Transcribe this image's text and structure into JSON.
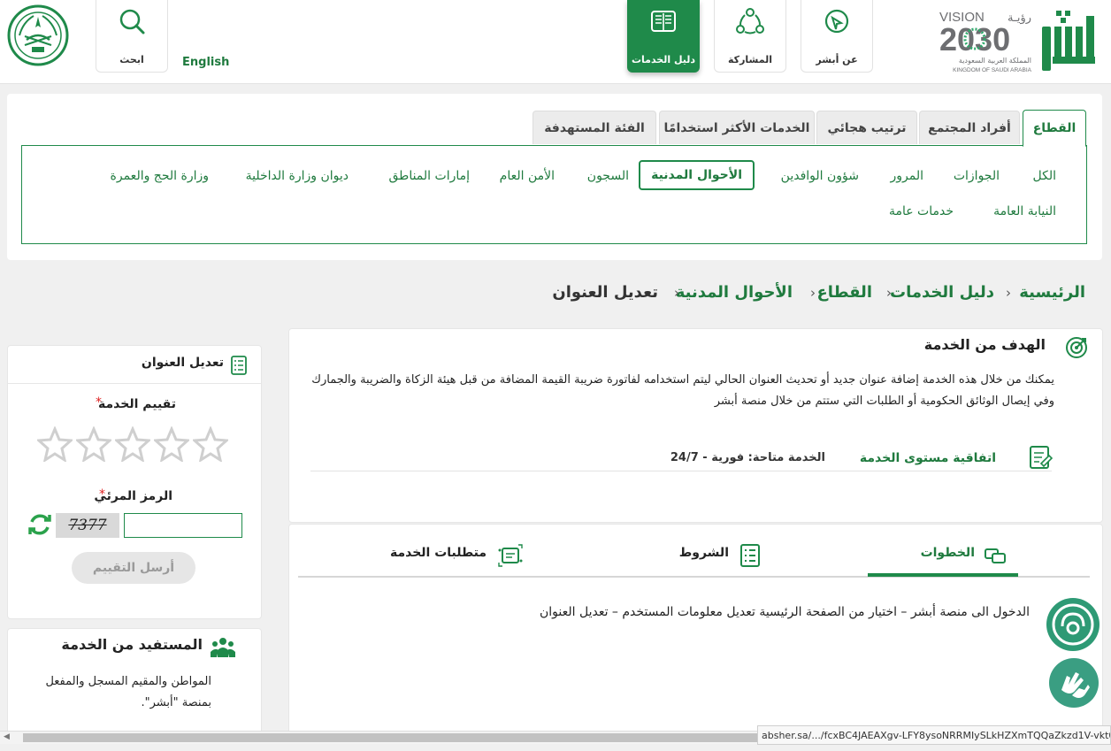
{
  "header": {
    "logo_top": "أبشر",
    "vision_word": "VISION",
    "vision_ar": "رؤيـة",
    "vision_year": "2030",
    "vision_kingdom_ar": "المملكة العربية السعودية",
    "vision_kingdom_en": "KINGDOM OF SAUDI ARABIA",
    "nav": [
      {
        "label": "عن أبشر",
        "icon": "absher-logo-icon"
      },
      {
        "label": "المشاركة",
        "icon": "share-network-icon"
      },
      {
        "label": "دليل الخدمات",
        "icon": "book-icon"
      }
    ],
    "english": "English",
    "search": {
      "label": "ابحث",
      "icon": "search-icon"
    }
  },
  "category": {
    "tabs": [
      "القطاع",
      "أفراد المجتمع",
      "ترتيب هجائي",
      "الخدمات الأكثر استخدامًا",
      "الفئة المستهدفة"
    ],
    "items_row1": [
      "الكل",
      "الجوازات",
      "المرور",
      "شؤون الوافدين",
      "الأحوال المدنية",
      "السجون",
      "الأمن العام",
      "إمارات المناطق",
      "ديوان وزارة الداخلية",
      "وزارة الحج والعمرة"
    ],
    "items_row2": [
      "النيابة العامة",
      "خدمات عامة"
    ]
  },
  "breadcrumb": [
    "الرئيسية",
    "دليل الخدمات",
    "القطاع",
    "الأحوال المدنية",
    "تعديل العنوان"
  ],
  "goal": {
    "title": "الهدف من الخدمة",
    "text": "يمكنك من خلال هذه الخدمة إضافة عنوان جديد أو تحديث العنوان الحالي ليتم استخدامه لفاتورة ضريبة القيمة المضافة من قبل هيئة الزكاة والضريبة والجمارك وفي إيصال الوثائق الحكومية أو الطلبات التي ستتم من خلال منصة أبشر",
    "sla_label": "اتفاقية مستوى الخدمة",
    "sla_value": "الخدمة متاحة: فورية - 24/7"
  },
  "steps": {
    "tabs": [
      "الخطوات",
      "الشروط",
      "متطلبات الخدمة"
    ],
    "text": "الدخول الى منصة أبشر – اختيار من الصفحة الرئيسية تعديل معلومات المستخدم – تعديل العنوان"
  },
  "rating": {
    "title": "تعديل العنوان",
    "rate_label": "تقييم الخدمة",
    "required": "*",
    "stars": 5,
    "captcha_label": "الرمز المرئي",
    "captcha_text": "7377",
    "captcha_input_value": "",
    "submit": "أرسل التقييم"
  },
  "beneficiary": {
    "title": "المستفيد من الخدمة",
    "text": "المواطن والمقيم المسجل والمفعل بمنصة \"أبشر\"."
  },
  "status_url": "absher.sa/.../fcxBC4JAEAXgv-LFY8ysoNRRMIySLkHZXmTQQaZkzd1V-vkt0aB",
  "colors": {
    "brand_green": "#1f8a4a",
    "text_green": "#1f7a3e",
    "widget_teal": "#2e9a75"
  }
}
